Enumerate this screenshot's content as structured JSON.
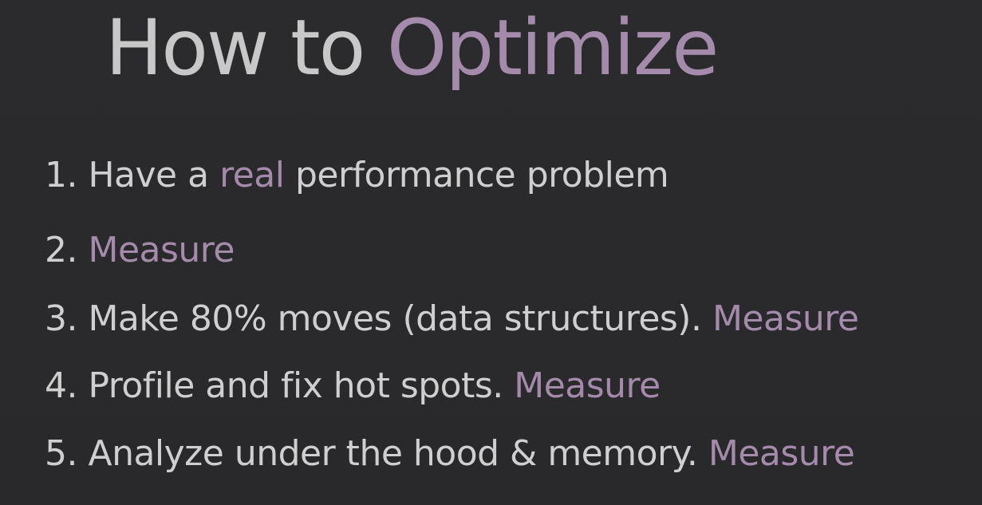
{
  "slide": {
    "title": {
      "prefix": "How to ",
      "highlight": "Optimize"
    },
    "steps": [
      {
        "number": "1.",
        "before": " Have a ",
        "highlight": "real",
        "after": " performance problem"
      },
      {
        "number": "2.",
        "before": " ",
        "highlight": "Measure",
        "after": ""
      },
      {
        "number": "3.",
        "before": " Make 80% moves (data structures). ",
        "highlight": "Measure",
        "after": ""
      },
      {
        "number": "4.",
        "before": " Profile and fix hot spots. ",
        "highlight": "Measure",
        "after": ""
      },
      {
        "number": "5.",
        "before": " Analyze under the hood & memory. ",
        "highlight": "Measure",
        "after": ""
      }
    ]
  },
  "colors": {
    "background": "#2a2a2c",
    "text": "#cfcfcf",
    "accent": "#a58bab"
  }
}
